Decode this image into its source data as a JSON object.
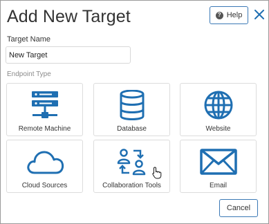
{
  "dialog": {
    "title": "Add New Target",
    "help_label": "Help",
    "close_icon": "close-icon",
    "cancel_label": "Cancel"
  },
  "form": {
    "target_name_label": "Target Name",
    "target_name_value": "New Target",
    "endpoint_type_label": "Endpoint Type"
  },
  "endpoints": [
    {
      "label": "Remote Machine",
      "icon": "server-icon"
    },
    {
      "label": "Database",
      "icon": "database-icon"
    },
    {
      "label": "Website",
      "icon": "globe-icon"
    },
    {
      "label": "Cloud Sources",
      "icon": "cloud-icon"
    },
    {
      "label": "Collaboration Tools",
      "icon": "collaboration-icon"
    },
    {
      "label": "Email",
      "icon": "envelope-icon"
    }
  ],
  "colors": {
    "accent": "#1f6fb2",
    "button_border": "#3a78b5"
  }
}
